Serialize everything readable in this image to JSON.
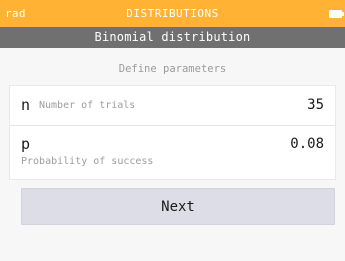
{
  "status_bar": {
    "angle_mode": "rad",
    "app_name": "DISTRIBUTIONS",
    "battery_icon": "battery-icon"
  },
  "title_bar": {
    "title": "Binomial distribution"
  },
  "section": {
    "label": "Define parameters"
  },
  "parameters": [
    {
      "symbol": "n",
      "description": "Number of trials",
      "value": "35"
    },
    {
      "symbol": "p",
      "description": "Probability of success",
      "value": "0.08"
    }
  ],
  "actions": {
    "next_label": "Next"
  },
  "colors": {
    "status_bar": "#ffb234",
    "title_bar": "#707070",
    "background": "#f7f7f7",
    "button": "#dcdde6"
  }
}
